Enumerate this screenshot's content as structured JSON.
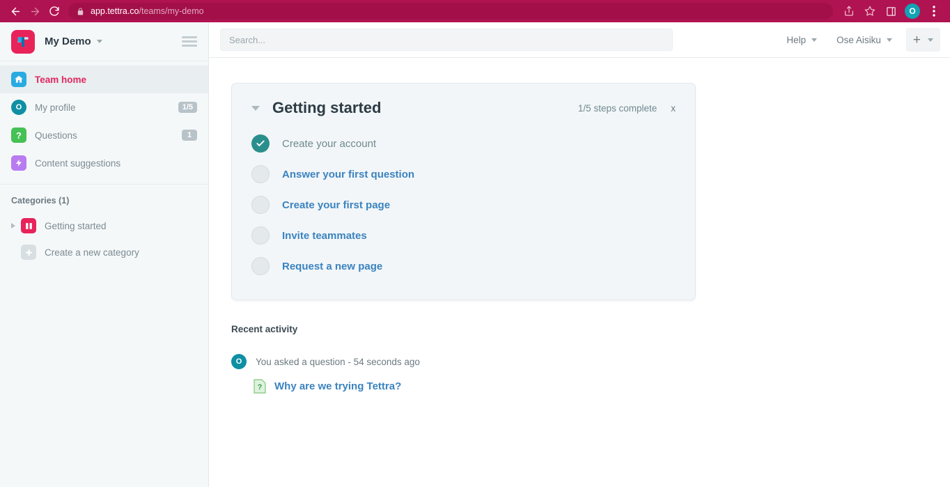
{
  "browser": {
    "url_bold": "app.tettra.co",
    "url_path": "/teams/my-demo",
    "back_icon": "back-arrow-icon",
    "forward_icon": "forward-arrow-icon",
    "reload_icon": "reload-icon",
    "lock_icon": "lock-icon",
    "share_icon": "share-icon",
    "bookmark_icon": "star-icon",
    "sidepanel_icon": "side-panel-icon",
    "profile_initial": "O",
    "menu_icon": "three-dot-menu-icon"
  },
  "sidebar": {
    "logo_icon": "tettra-logo-icon",
    "team_name": "My Demo",
    "team_caret_icon": "chevron-down-icon",
    "hamburger_icon": "hamburger-menu-icon",
    "nav": [
      {
        "label": "Team home",
        "icon": "home-icon",
        "badge": "",
        "active": true
      },
      {
        "label": "My profile",
        "icon": "avatar-icon",
        "badge": "1/5",
        "active": false
      },
      {
        "label": "Questions",
        "icon": "question-mark-icon",
        "badge": "1",
        "active": false
      },
      {
        "label": "Content suggestions",
        "icon": "lightning-bolt-icon",
        "badge": "",
        "active": false
      }
    ],
    "profile_initial": "O",
    "categories_title": "Categories (1)",
    "categories": [
      {
        "label": "Getting started",
        "icon": "book-icon",
        "expand_icon": "triangle-right-icon"
      }
    ],
    "create_category_label": "Create a new category",
    "create_category_icon": "plus-icon"
  },
  "topbar": {
    "search_placeholder": "Search...",
    "search_value": "",
    "help_label": "Help",
    "user_label": "Ose Aisiku",
    "caret_icon": "chevron-down-icon",
    "plus_label": "+",
    "plus_icon": "plus-icon"
  },
  "getting_started": {
    "collapse_icon": "triangle-down-icon",
    "title": "Getting started",
    "steps_complete": "1/5 steps complete",
    "close_label": "x",
    "items": [
      {
        "label": "Create your account",
        "done": true,
        "icon": "check-circle-icon"
      },
      {
        "label": "Answer your first question",
        "done": false,
        "icon": "empty-circle-icon"
      },
      {
        "label": "Create your first page",
        "done": false,
        "icon": "empty-circle-icon"
      },
      {
        "label": "Invite teammates",
        "done": false,
        "icon": "empty-circle-icon"
      },
      {
        "label": "Request a new page",
        "done": false,
        "icon": "empty-circle-icon"
      }
    ]
  },
  "recent_activity": {
    "title": "Recent activity",
    "avatar_initial": "O",
    "entry_text": "You asked a question - 54 seconds ago",
    "question_icon": "question-document-icon",
    "question_link": "Why are we trying Tettra?"
  },
  "colors": {
    "brand_pink": "#e8235a",
    "browser_bar": "#b01351",
    "teal": "#0f8fa3",
    "link_blue": "#3b83c0",
    "done_teal": "#2a8f8c",
    "green": "#45c156",
    "purple": "#b87cf0",
    "blue": "#29abe2"
  }
}
